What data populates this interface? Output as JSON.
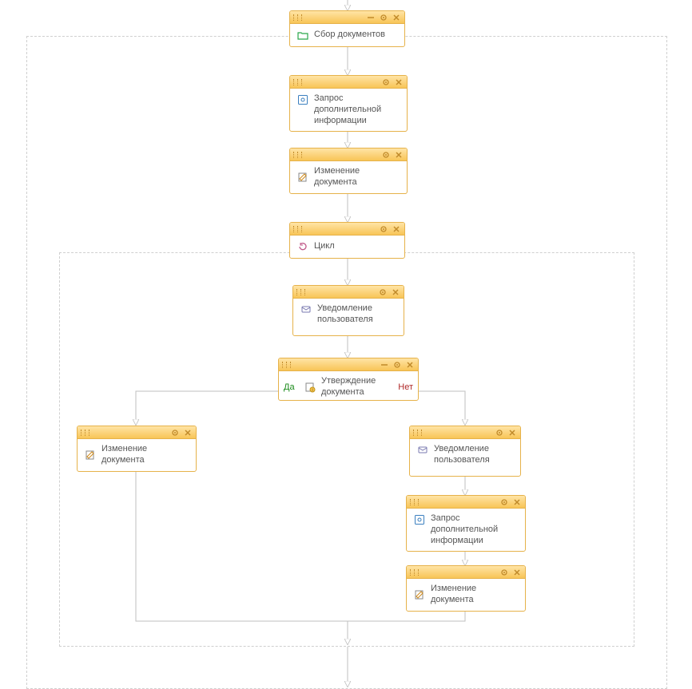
{
  "nodes": {
    "collect_docs": {
      "label": "Сбор документов"
    },
    "request_info_1": {
      "label": "Запрос дополнительной информации"
    },
    "edit_doc_1": {
      "label": "Изменение документа"
    },
    "loop": {
      "label": "Цикл"
    },
    "notify_user_1": {
      "label": "Уведомление пользователя"
    },
    "approve": {
      "label": "Утверждение документа",
      "yes": "Да",
      "no": "Нет"
    },
    "edit_doc_left": {
      "label": "Изменение документа"
    },
    "notify_user_right": {
      "label": "Уведомление пользователя"
    },
    "request_info_2": {
      "label": "Запрос дополнительной информации"
    },
    "edit_doc_right": {
      "label": "Изменение документа"
    }
  }
}
